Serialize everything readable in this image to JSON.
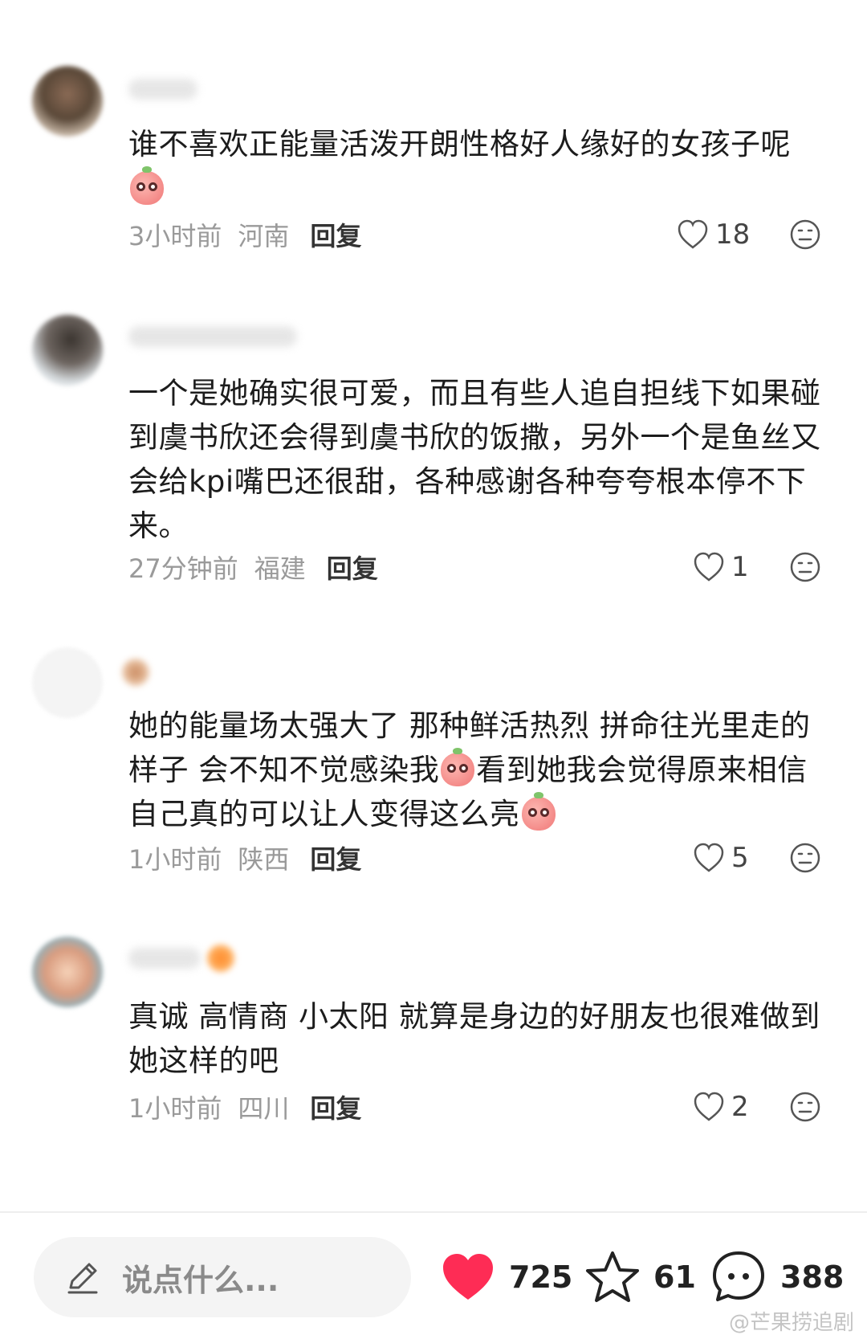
{
  "comments": [
    {
      "text_parts": [
        "谁不喜欢正能量活泼开朗性格好人缘好的女孩子呢",
        ""
      ],
      "time": "3小时前",
      "location": "河南",
      "reply_label": "回复",
      "likes": "18"
    },
    {
      "text": "一个是她确实很可爱，而且有些人追自担线下如果碰到虞书欣还会得到虞书欣的饭撒，另外一个是鱼丝又会给kpi嘴巴还很甜，各种感谢各种夸夸根本停不下来。",
      "time": "27分钟前",
      "location": "福建",
      "reply_label": "回复",
      "likes": "1"
    },
    {
      "text_parts": [
        "她的能量场太强大了 那种鲜活热烈 拼命往光里走的样子 会不知不觉感染我",
        "看到她我会觉得原来相信自己真的可以让人变得这么亮",
        ""
      ],
      "time": "1小时前",
      "location": "陕西",
      "reply_label": "回复",
      "likes": "5"
    },
    {
      "text": "真诚 高情商 小太阳 就算是身边的好朋友也很难做到她这样的吧",
      "time": "1小时前",
      "location": "四川",
      "reply_label": "回复",
      "likes": "2"
    }
  ],
  "bottom_bar": {
    "input_placeholder": "说点什么...",
    "like_count": "725",
    "favorite_count": "61",
    "comment_count": "388"
  },
  "watermark": "@芒果捞追剧",
  "icons": {
    "like": "heart-outline-icon",
    "dislike": "unhappy-face-icon",
    "emoji": "peach-emoji-icon",
    "edit": "pencil-icon",
    "liked": "heart-filled-icon",
    "favorite": "star-icon",
    "comment": "chat-bubble-icon"
  },
  "colors": {
    "accent_like": "#fe2c55",
    "meta_text": "#9a9a9a",
    "body_text": "#1c1c1c"
  }
}
